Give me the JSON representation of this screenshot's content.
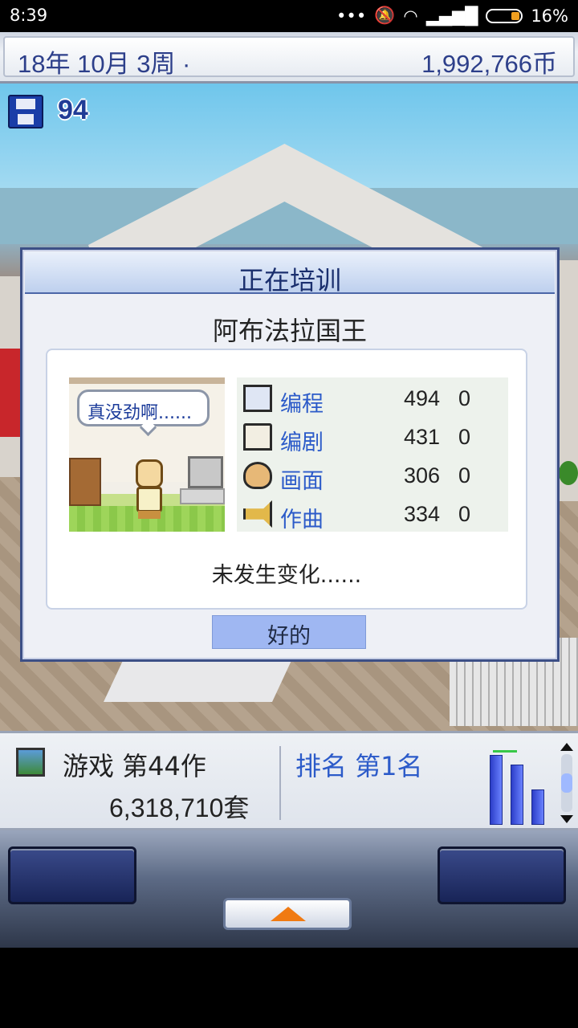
{
  "status_bar": {
    "time": "8:39",
    "icons": [
      "more-dots-icon",
      "mute-icon",
      "wifi-icon",
      "signal-icon",
      "battery-icon"
    ],
    "battery_percent": "16%"
  },
  "top_bar": {
    "date": "18年 10月 3周 ·",
    "money": "1,992,766币"
  },
  "save": {
    "count": "94"
  },
  "dialog": {
    "title": "正在培训",
    "employee_name": "阿布法拉国王",
    "speech_bubble": "真没劲啊......",
    "stats": [
      {
        "label": "编程",
        "value": "494",
        "delta": "0",
        "icon": "monitor-icon"
      },
      {
        "label": "编剧",
        "value": "431",
        "delta": "0",
        "icon": "book-icon"
      },
      {
        "label": "画面",
        "value": "306",
        "delta": "0",
        "icon": "palette-icon"
      },
      {
        "label": "作曲",
        "value": "334",
        "delta": "0",
        "icon": "trumpet-icon"
      }
    ],
    "result_text": "未发生变化......",
    "ok_label": "好的"
  },
  "info_bar": {
    "game_label": "游戏 第44作",
    "game_sales": "6,318,710套",
    "rank_label": "排名 第1名",
    "sales_chart": {
      "bar_levels": [
        0.95,
        0.82,
        0.48
      ]
    }
  },
  "colors": {
    "accent_blue": "#2c5bc9",
    "title_blue": "#1a2f6e",
    "ok_button": "#9fb7f2",
    "menu_arrow": "#f07a12"
  }
}
